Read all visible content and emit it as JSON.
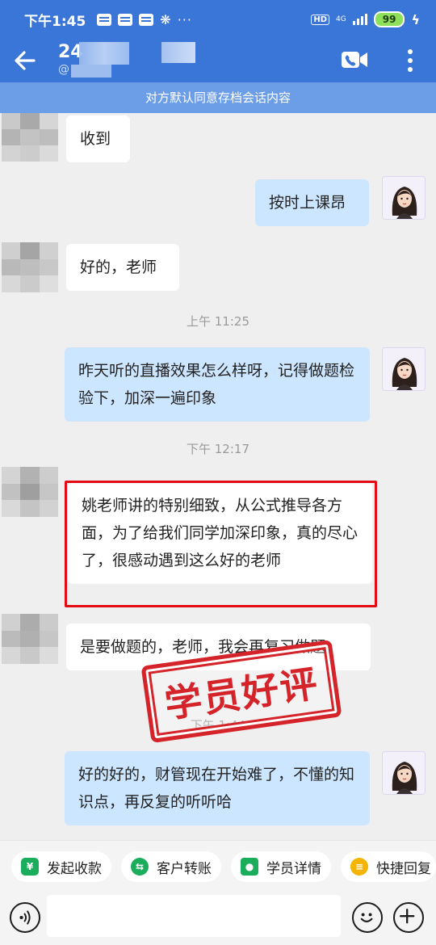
{
  "status_bar": {
    "time": "下午1:45",
    "more_indicator": "···",
    "hd": "HD",
    "network": "4G",
    "battery": "99"
  },
  "header": {
    "title": "24",
    "subtitle": "@"
  },
  "notice": "对方默认同意存档会话内容",
  "messages": [
    {
      "side": "left",
      "text": "收到"
    },
    {
      "side": "right",
      "text": "按时上课昂"
    },
    {
      "side": "left",
      "text": "好的，老师"
    },
    {
      "side": "right",
      "text": "昨天听的直播效果怎么样呀，记得做题检验下，加深一遍印象"
    },
    {
      "side": "left",
      "text": "姚老师讲的特别细致，从公式推导各方面，为了给我们同学加深印象，真的尽心了，很感动遇到这么好的老师"
    },
    {
      "side": "left",
      "text": "是要做题的，老师，我会再复习做题"
    },
    {
      "side": "right",
      "text": "好的好的，财管现在开始难了，不懂的知识点，再反复的听听哈"
    }
  ],
  "timestamps": [
    "上午 11:25",
    "下午 12:17",
    "下午 1:44"
  ],
  "stamp_text": "学员好评",
  "quick_actions": [
    {
      "label": "发起收款",
      "icon": "yen-icon",
      "color": "#1aad5b",
      "glyph": "¥"
    },
    {
      "label": "客户转账",
      "icon": "transfer-icon",
      "color": "#1aad5b",
      "glyph": "⇆"
    },
    {
      "label": "学员详情",
      "icon": "student-icon",
      "color": "#1aad5b",
      "glyph": "👤"
    },
    {
      "label": "快捷回复",
      "icon": "quick-reply-icon",
      "color": "#f5b400",
      "glyph": "≡"
    }
  ],
  "input": {
    "placeholder": ""
  },
  "colors": {
    "header_blue": "#3a75d8",
    "notice_blue": "#6c9ee8",
    "bubble_right": "#cde6ff",
    "highlight_red": "#e40a12",
    "stamp_red": "#d4242a"
  }
}
